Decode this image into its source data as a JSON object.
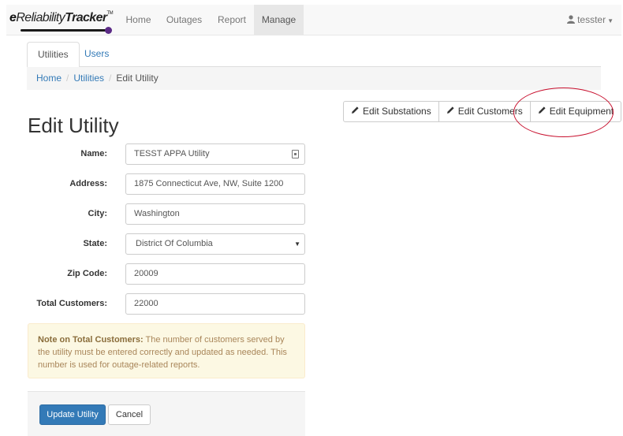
{
  "brand": {
    "prefix": "e",
    "middle": "Reliability",
    "suffix": "Tracker",
    "tm": "TM",
    "accent_color": "#5b2a86"
  },
  "nav": {
    "items": [
      "Home",
      "Outages",
      "Report",
      "Manage"
    ],
    "active": "Manage",
    "user": "tesster",
    "user_icon": "person-icon",
    "caret_icon": "caret-down-icon"
  },
  "tabs": {
    "items": [
      "Utilities",
      "Users"
    ],
    "active": "Utilities"
  },
  "breadcrumb": [
    "Home",
    "Utilities",
    "Edit Utility"
  ],
  "actions_top": {
    "edit_substations": "Edit Substations",
    "edit_customers": "Edit Customers",
    "edit_equipment": "Edit Equipment",
    "icon": "pencil-icon",
    "highlight_color": "#c8102e"
  },
  "page_title": "Edit Utility",
  "form": {
    "name_label": "Name:",
    "name_value": "TESST APPA Utility",
    "address_label": "Address:",
    "address_value": "1875 Connecticut Ave, NW, Suite 1200",
    "city_label": "City:",
    "city_value": "Washington",
    "state_label": "State:",
    "state_value": "District Of Columbia",
    "zip_label": "Zip Code:",
    "zip_value": "20009",
    "total_label": "Total Customers:",
    "total_value": "22000"
  },
  "note": {
    "title": "Note on Total Customers:",
    "body": " The number of customers served by the utility must be entered correctly and updated as needed. This number is used for outage-related reports.",
    "bg_color": "#fcf8e3"
  },
  "buttons": {
    "update": "Update Utility",
    "cancel": "Cancel",
    "primary_color": "#337ab7"
  }
}
